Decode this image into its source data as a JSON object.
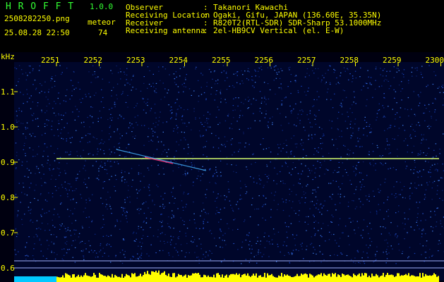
{
  "app": {
    "name": "H R O F F T",
    "version": "1.0.0"
  },
  "file": {
    "name": "2508282250.png",
    "datetime": "25.08.28 22:50"
  },
  "meteor": {
    "label": "meteor",
    "count": "74"
  },
  "info": [
    {
      "key": "Observer",
      "value": "Takanori Kawachi"
    },
    {
      "key": "Receiving Location",
      "value": "Ogaki, Gifu, JAPAN (136.60E, 35.35N)"
    },
    {
      "key": "Receiver",
      "value": "R820T2(RTL-SDR) SDR-Sharp 53.1000MHz"
    },
    {
      "key": "Receiving antenna",
      "value": "2el-HB9CV Vertical (el. E-W)"
    }
  ],
  "axes": {
    "y_unit": "kHz",
    "x_ticks": [
      "2251",
      "2252",
      "2253",
      "2254",
      "2255",
      "2256",
      "2257",
      "2258",
      "2259",
      "2300"
    ],
    "y_ticks": [
      "1.1",
      "1.0",
      "0.9",
      "0.8",
      "0.7",
      "0.6"
    ]
  },
  "colors": {
    "header": "#ffff00",
    "app_title": "#33ff33",
    "background": "#000010",
    "signal": "#d8ff70",
    "level": "#ffff00",
    "level_base": "#00c8ff"
  }
}
